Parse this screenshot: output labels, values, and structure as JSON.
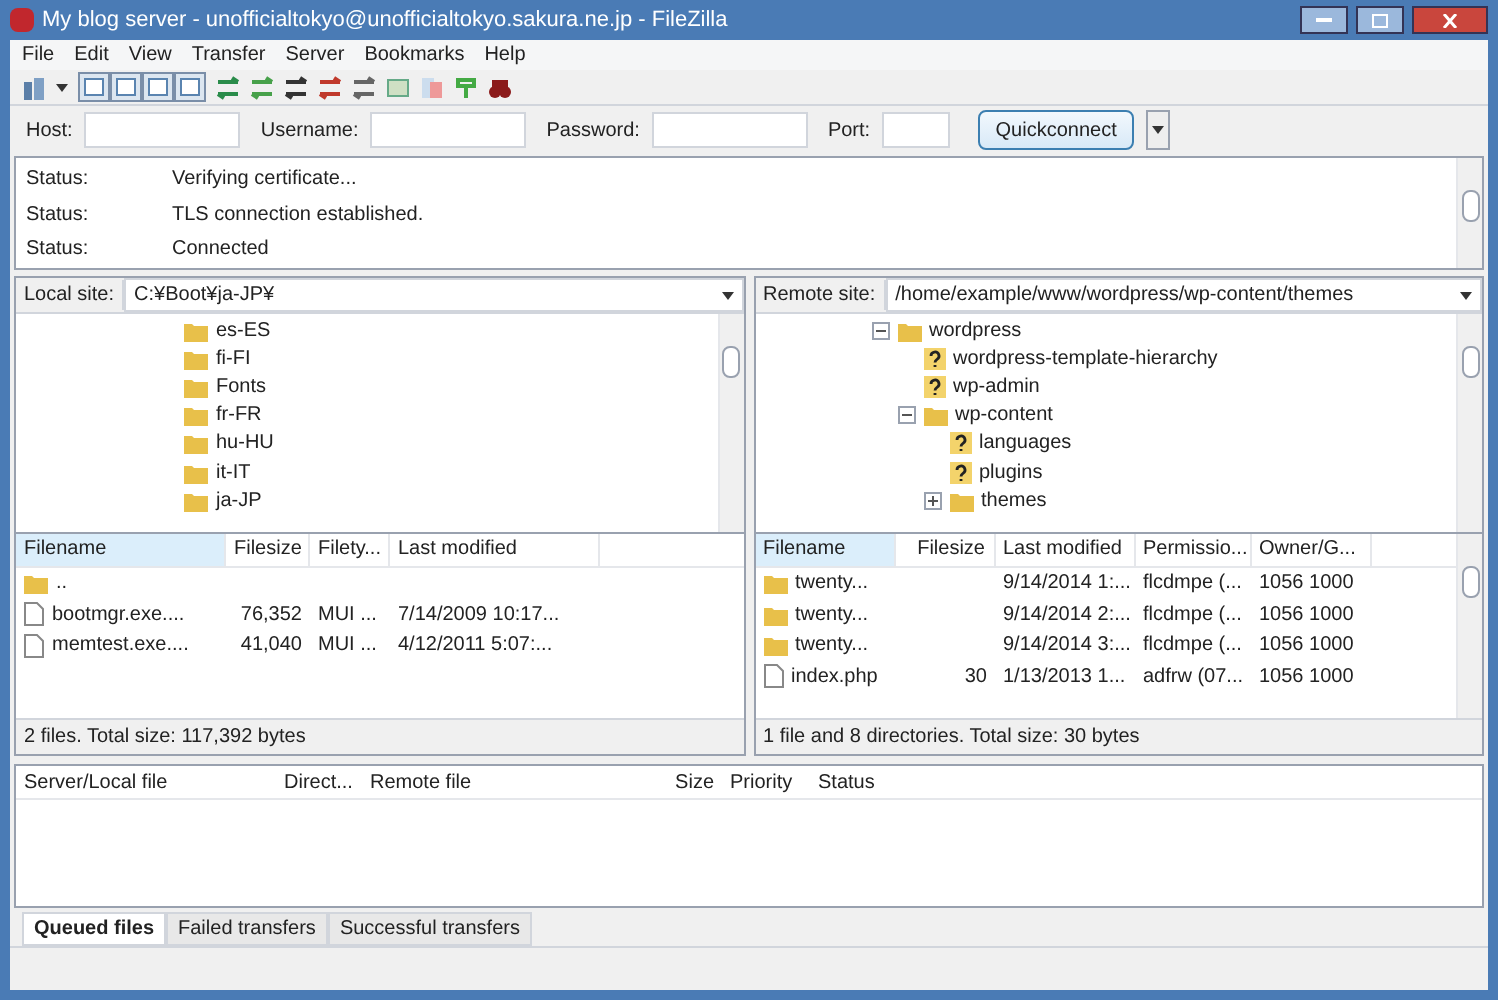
{
  "window": {
    "title": "My blog server - unofficialtokyo@unofficialtokyo.sakura.ne.jp - FileZilla"
  },
  "menu": [
    "File",
    "Edit",
    "View",
    "Transfer",
    "Server",
    "Bookmarks",
    "Help"
  ],
  "toolbar_toggles": [
    {
      "on": true
    },
    {
      "on": true
    },
    {
      "on": true
    },
    {
      "on": true
    }
  ],
  "quickconnect": {
    "fields": [
      {
        "label": "Host:"
      },
      {
        "label": "Username:"
      },
      {
        "label": "Password:"
      },
      {
        "label": "Port:"
      }
    ],
    "button": "Quickconnect"
  },
  "log": [
    {
      "label": "Status:",
      "message": "Verifying certificate..."
    },
    {
      "label": "Status:",
      "message": "TLS connection established."
    },
    {
      "label": "Status:",
      "message": "Connected"
    }
  ],
  "local": {
    "site_label": "Local site:",
    "path": "C:¥Boot¥ja-JP¥",
    "tree": [
      {
        "name": "es-ES",
        "kind": "folder"
      },
      {
        "name": "fi-FI",
        "kind": "folder"
      },
      {
        "name": "Fonts",
        "kind": "folder"
      },
      {
        "name": "fr-FR",
        "kind": "folder"
      },
      {
        "name": "hu-HU",
        "kind": "folder"
      },
      {
        "name": "it-IT",
        "kind": "folder"
      },
      {
        "name": "ja-JP",
        "kind": "folder"
      }
    ],
    "columns": [
      {
        "label": "Filename",
        "sorted": true
      },
      {
        "label": "Filesize",
        "sorted": false
      },
      {
        "label": "Filety...",
        "sorted": false
      },
      {
        "label": "Last modified",
        "sorted": false
      }
    ],
    "rows": [
      {
        "kind": "folder",
        "cells": [
          "..",
          "",
          "",
          ""
        ]
      },
      {
        "kind": "file",
        "cells": [
          "bootmgr.exe....",
          "76,352",
          "MUI ...",
          "7/14/2009 10:17..."
        ]
      },
      {
        "kind": "file",
        "cells": [
          "memtest.exe....",
          "41,040",
          "MUI ...",
          "4/12/2011 5:07:..."
        ]
      }
    ],
    "status": "2 files. Total size: 117,392 bytes"
  },
  "remote": {
    "site_label": "Remote site:",
    "path": "/home/example/www/wordpress/wp-content/themes",
    "tree": [
      {
        "name": "wordpress",
        "kind": "folder",
        "expanded": true,
        "children": [
          {
            "name": "wordpress-template-hierarchy",
            "kind": "unknown"
          },
          {
            "name": "wp-admin",
            "kind": "unknown"
          },
          {
            "name": "wp-content",
            "kind": "folder",
            "expanded": true,
            "children": [
              {
                "name": "languages",
                "kind": "unknown"
              },
              {
                "name": "plugins",
                "kind": "unknown"
              },
              {
                "name": "themes",
                "kind": "folder",
                "expanded": false
              }
            ]
          }
        ]
      }
    ],
    "columns": [
      {
        "label": "Filename",
        "sorted": true
      },
      {
        "label": "Filesize",
        "sorted": false
      },
      {
        "label": "Last modified",
        "sorted": false
      },
      {
        "label": "Permissio...",
        "sorted": false
      },
      {
        "label": "Owner/G...",
        "sorted": false
      }
    ],
    "rows": [
      {
        "kind": "folder",
        "cells": [
          "twenty...",
          "",
          "9/14/2014 1:...",
          "flcdmpe (...",
          "1056 1000"
        ]
      },
      {
        "kind": "folder",
        "cells": [
          "twenty...",
          "",
          "9/14/2014 2:...",
          "flcdmpe (...",
          "1056 1000"
        ]
      },
      {
        "kind": "folder",
        "cells": [
          "twenty...",
          "",
          "9/14/2014 3:...",
          "flcdmpe (...",
          "1056 1000"
        ]
      },
      {
        "kind": "file",
        "cells": [
          "index.php",
          "30",
          "1/13/2013 1...",
          "adfrw (07...",
          "1056 1000"
        ]
      }
    ],
    "status": "1 file and 8 directories. Total size: 30 bytes"
  },
  "queue": {
    "columns": [
      "Server/Local file",
      "Direct...",
      "Remote file",
      "Size",
      "Priority",
      "Status"
    ]
  },
  "tabs": [
    {
      "label": "Queued files",
      "selected": true
    },
    {
      "label": "Failed transfers",
      "selected": false
    },
    {
      "label": "Successful transfers",
      "selected": false
    }
  ]
}
